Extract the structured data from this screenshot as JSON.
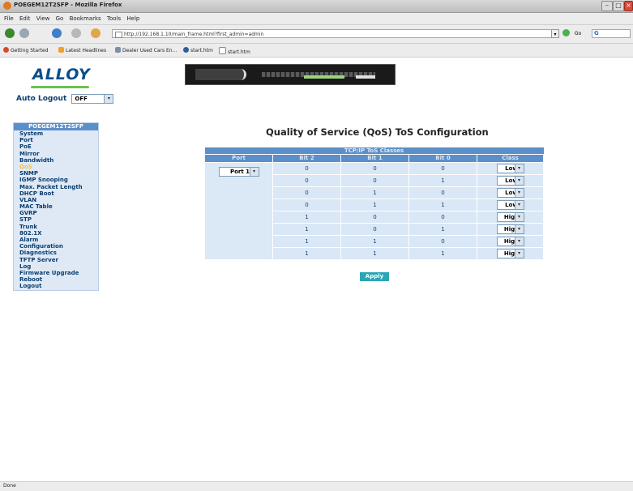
{
  "browser": {
    "window_title": "POEGEM12T2SFP - Mozilla Firefox",
    "menu": [
      "File",
      "Edit",
      "View",
      "Go",
      "Bookmarks",
      "Tools",
      "Help"
    ],
    "url": "http://192.168.1.10/main_frame.html?first_admin=admin",
    "search_label": "G",
    "bookmarks": [
      "Getting Started",
      "Latest Headlines",
      "Dealer Used Cars En...",
      "start.htm",
      "start.htm"
    ],
    "status": "Done"
  },
  "header": {
    "logo_text": "ALLOY",
    "auto_logout_label": "Auto Logout",
    "auto_logout_value": "OFF"
  },
  "sidebar": {
    "title": "POEGEM12T2SFP",
    "items": [
      {
        "label": "System"
      },
      {
        "label": "Port"
      },
      {
        "label": "PoE"
      },
      {
        "label": "Mirror"
      },
      {
        "label": "Bandwidth"
      },
      {
        "label": "QoS",
        "active": true
      },
      {
        "label": "SNMP"
      },
      {
        "label": "IGMP Snooping"
      },
      {
        "label": "Max. Packet Length"
      },
      {
        "label": "DHCP Boot"
      },
      {
        "label": "VLAN"
      },
      {
        "label": "MAC Table"
      },
      {
        "label": "GVRP"
      },
      {
        "label": "STP"
      },
      {
        "label": "Trunk"
      },
      {
        "label": "802.1X"
      },
      {
        "label": "Alarm"
      },
      {
        "label": "Configuration"
      },
      {
        "label": "Diagnostics"
      },
      {
        "label": "TFTP Server"
      },
      {
        "label": "Log"
      },
      {
        "label": "Firmware Upgrade"
      },
      {
        "label": "Reboot"
      },
      {
        "label": "Logout"
      }
    ]
  },
  "main": {
    "title": "Quality of Service (QoS) ToS Configuration",
    "table_caption": "TCP/IP ToS Classes",
    "columns": [
      "Port",
      "Bit 2",
      "Bit 1",
      "Bit 0",
      "Class"
    ],
    "port_value": "Port 1",
    "rows": [
      {
        "bit2": "0",
        "bit1": "0",
        "bit0": "0",
        "class": "Low"
      },
      {
        "bit2": "0",
        "bit1": "0",
        "bit0": "1",
        "class": "Low"
      },
      {
        "bit2": "0",
        "bit1": "1",
        "bit0": "0",
        "class": "Low"
      },
      {
        "bit2": "0",
        "bit1": "1",
        "bit0": "1",
        "class": "Low"
      },
      {
        "bit2": "1",
        "bit1": "0",
        "bit0": "0",
        "class": "High"
      },
      {
        "bit2": "1",
        "bit1": "0",
        "bit0": "1",
        "class": "High"
      },
      {
        "bit2": "1",
        "bit1": "1",
        "bit0": "0",
        "class": "High"
      },
      {
        "bit2": "1",
        "bit1": "1",
        "bit0": "1",
        "class": "High"
      }
    ],
    "apply_label": "Apply"
  },
  "colors": {
    "table_header": "#5b8fc9",
    "table_cell": "#d9e7f6",
    "apply_button": "#2aa6b5",
    "active_nav": "#f4c33e"
  }
}
